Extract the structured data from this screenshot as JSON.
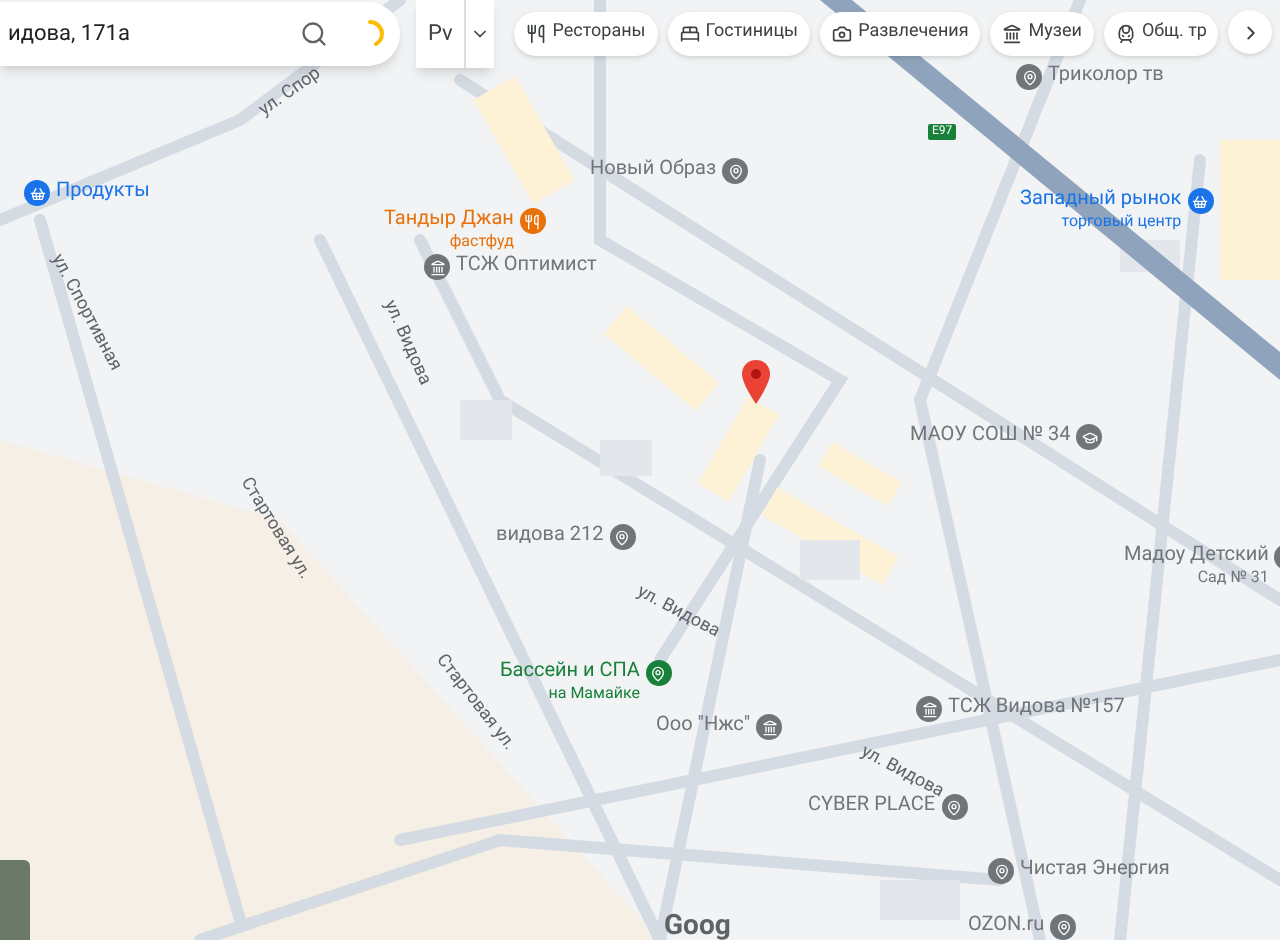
{
  "search": {
    "value": "идова, 171а"
  },
  "layers_button": {
    "label": "Рv"
  },
  "chips": [
    {
      "label": "Рестораны",
      "kind": "restaurant"
    },
    {
      "label": "Гостиницы",
      "kind": "hotel"
    },
    {
      "label": "Развлечения",
      "kind": "camera"
    },
    {
      "label": "Музеи",
      "kind": "museum"
    },
    {
      "label": "Общ. тр",
      "kind": "transit"
    }
  ],
  "road_badge": "E97",
  "streets": [
    "ул. Спор",
    "ул. Спортивная",
    "ул. Видова",
    "Стартовая ул.",
    "Стартовая ул.",
    "ул. Видова",
    "ул. Видова"
  ],
  "places": [
    {
      "lines": [
        "Продукты"
      ],
      "color": "#1a73e8",
      "kind": "shop"
    },
    {
      "lines": [
        "Тандыр Джан",
        "фастфуд"
      ],
      "color": "#e8710a",
      "kind": "food"
    },
    {
      "lines": [
        "ТСЖ Оптимист"
      ],
      "color": "#70757a",
      "kind": "building"
    },
    {
      "lines": [
        "Новый Образ"
      ],
      "color": "#70757a",
      "kind": "pin"
    },
    {
      "lines": [
        "Триколор тв"
      ],
      "color": "#70757a",
      "kind": "pin"
    },
    {
      "lines": [
        "Западный рынок",
        "торговый центр"
      ],
      "color": "#1a73e8",
      "kind": "shop"
    },
    {
      "lines": [
        "МАОУ СОШ № 34"
      ],
      "color": "#70757a",
      "kind": "school"
    },
    {
      "lines": [
        "Мадоу Детский",
        "Сад № 31"
      ],
      "color": "#70757a",
      "kind": "school"
    },
    {
      "lines": [
        "видова 212"
      ],
      "color": "#70757a",
      "kind": "pin"
    },
    {
      "lines": [
        "Бассейн и СПА",
        "на Мамайке"
      ],
      "color": "#188038",
      "kind": "pin"
    },
    {
      "lines": [
        "Ооо \"Нжс\""
      ],
      "color": "#70757a",
      "kind": "building"
    },
    {
      "lines": [
        "ТСЖ Видова №157"
      ],
      "color": "#70757a",
      "kind": "building"
    },
    {
      "lines": [
        "CYBER PLACE"
      ],
      "color": "#70757a",
      "kind": "pin"
    },
    {
      "lines": [
        "Чистая Энергия"
      ],
      "color": "#70757a",
      "kind": "pin"
    },
    {
      "lines": [
        "OZON.ru"
      ],
      "color": "#70757a",
      "kind": "pin"
    }
  ],
  "logo": "Goog"
}
